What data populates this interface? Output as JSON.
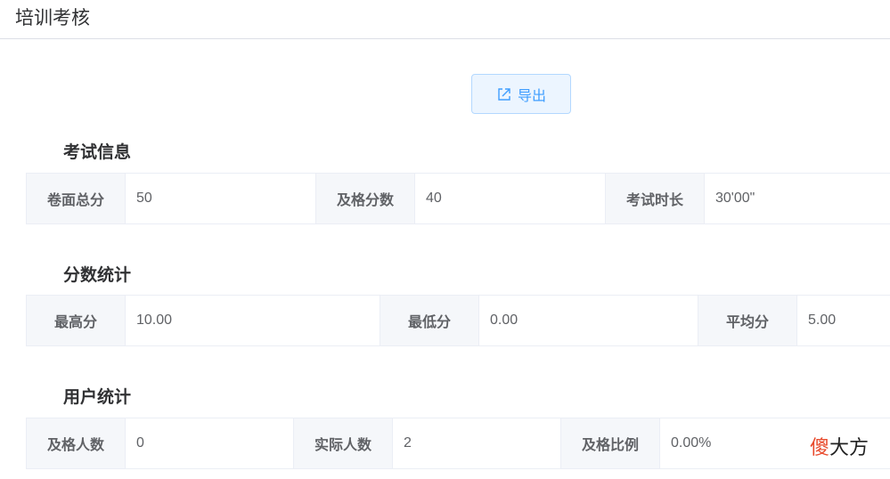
{
  "page": {
    "title": "培训考核"
  },
  "toolbar": {
    "export_label": "导出"
  },
  "exam_info": {
    "title": "考试信息",
    "fields": [
      {
        "label": "卷面总分",
        "value": "50"
      },
      {
        "label": "及格分数",
        "value": "40"
      },
      {
        "label": "考试时长",
        "value": "30'00\""
      }
    ]
  },
  "score_stats": {
    "title": "分数统计",
    "fields": [
      {
        "label": "最高分",
        "value": "10.00"
      },
      {
        "label": "最低分",
        "value": "0.00"
      },
      {
        "label": "平均分",
        "value": "5.00"
      }
    ]
  },
  "user_stats": {
    "title": "用户统计",
    "fields": [
      {
        "label": "及格人数",
        "value": "0"
      },
      {
        "label": "实际人数",
        "value": "2"
      },
      {
        "label": "及格比例",
        "value": "0.00%"
      }
    ]
  },
  "watermark": {
    "first": "傻",
    "rest": "大方"
  },
  "colors": {
    "accent": "#409eff",
    "label_bg": "#f5f7fa",
    "border": "#ebeef5"
  }
}
